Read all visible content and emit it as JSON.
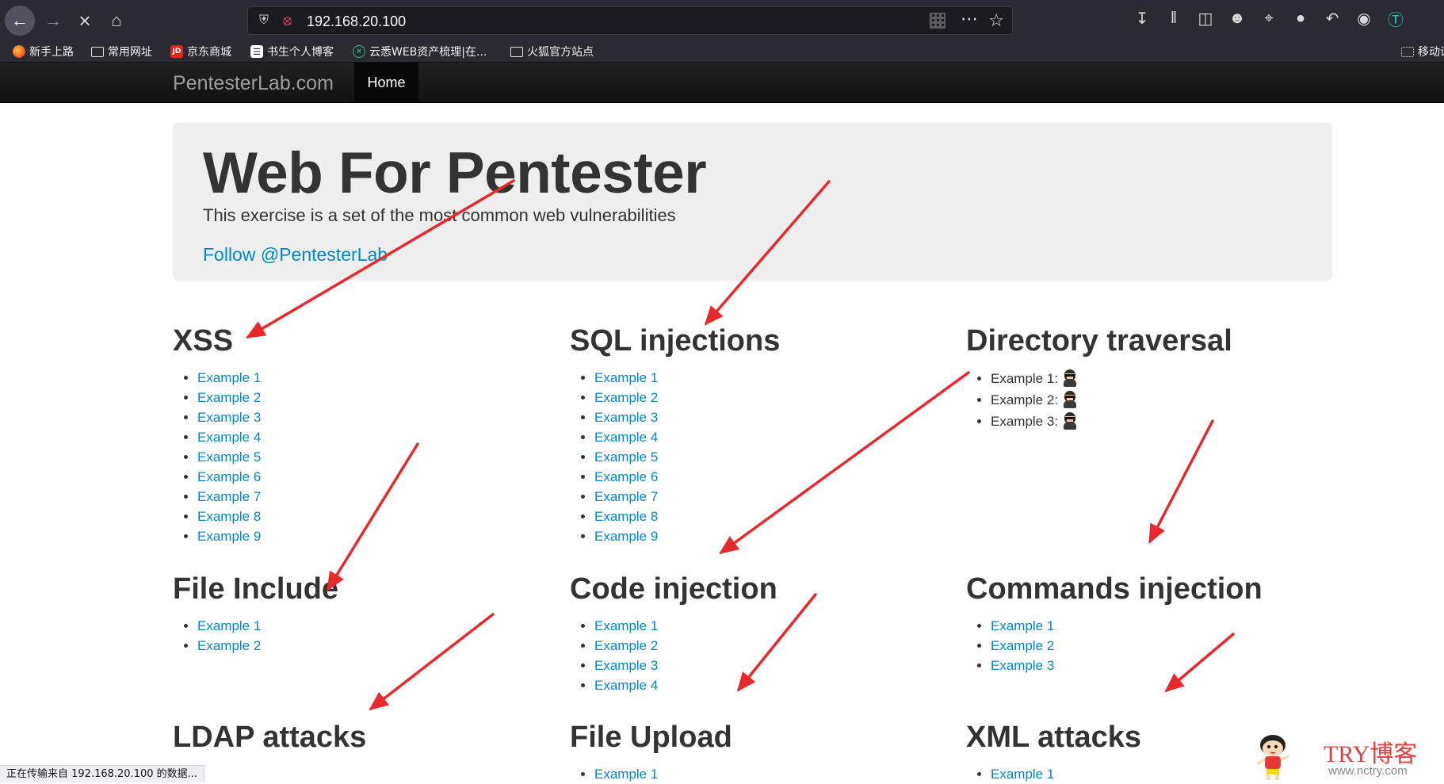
{
  "browser": {
    "url": "192.168.20.100",
    "bookmarks": [
      {
        "label": "新手上路",
        "icon": "firefox-icon"
      },
      {
        "label": "常用网址",
        "icon": "folder-icon"
      },
      {
        "label": "京东商城",
        "icon": "jd-icon",
        "icon_text": "JD"
      },
      {
        "label": "书生个人博客",
        "icon": "book-icon"
      },
      {
        "label": "云悉WEB资产梳理|在...",
        "icon": "cloud-icon"
      },
      {
        "label": "火狐官方站点",
        "icon": "folder-icon"
      }
    ],
    "mobile_bookmarks_label": "移动设",
    "status_text": "正在传输来自 192.168.20.100 的数据..."
  },
  "navbar": {
    "brand": "PentesterLab.com",
    "home_label": "Home"
  },
  "hero": {
    "title": "Web For Pentester",
    "subtitle": "This exercise is a set of the most common web vulnerabilities",
    "follow_link": "Follow @PentesterLab"
  },
  "sections": {
    "xss": {
      "title": "XSS",
      "items": [
        "Example 1",
        "Example 2",
        "Example 3",
        "Example 4",
        "Example 5",
        "Example 6",
        "Example 7",
        "Example 8",
        "Example 9"
      ]
    },
    "sql": {
      "title": "SQL injections",
      "items": [
        "Example 1",
        "Example 2",
        "Example 3",
        "Example 4",
        "Example 5",
        "Example 6",
        "Example 7",
        "Example 8",
        "Example 9"
      ]
    },
    "dir": {
      "title": "Directory traversal",
      "items": [
        "Example 1:",
        "Example 2:",
        "Example 3:"
      ]
    },
    "file_include": {
      "title": "File Include",
      "items": [
        "Example 1",
        "Example 2"
      ]
    },
    "code": {
      "title": "Code injection",
      "items": [
        "Example 1",
        "Example 2",
        "Example 3",
        "Example 4"
      ]
    },
    "commands": {
      "title": "Commands injection",
      "items": [
        "Example 1",
        "Example 2",
        "Example 3"
      ]
    },
    "ldap": {
      "title": "LDAP attacks",
      "items": []
    },
    "upload": {
      "title": "File Upload",
      "items": [
        "Example 1"
      ]
    },
    "xml": {
      "title": "XML attacks",
      "items": [
        "Example 1"
      ]
    }
  },
  "watermark": {
    "title": "TRY博客",
    "url": "www.nctry.com"
  },
  "colors": {
    "link": "#0088cc",
    "annotation_arrow": "#e8292c",
    "navbar": "#111111",
    "hero_bg": "#eeeeee"
  }
}
